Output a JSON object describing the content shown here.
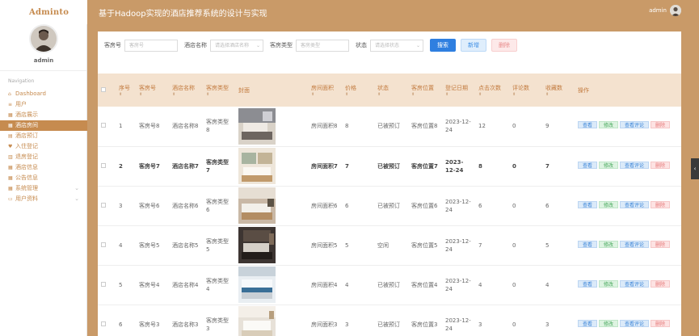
{
  "app": {
    "logo": "Adminto",
    "title": "基于Hadoop实现的酒店推荐系统的设计与实现",
    "user": "admin"
  },
  "sidebar": {
    "username": "admin",
    "nav_heading": "Navigation",
    "items": [
      {
        "icon": "home-icon",
        "glyph": "⌂",
        "label": "Dashboard"
      },
      {
        "icon": "list-icon",
        "glyph": "≡",
        "label": "用户"
      },
      {
        "icon": "grid-icon",
        "glyph": "▦",
        "label": "酒店展示"
      },
      {
        "icon": "grid-icon",
        "glyph": "▦",
        "label": "酒店房间",
        "active": true
      },
      {
        "icon": "book-icon",
        "glyph": "▤",
        "label": "酒店预订"
      },
      {
        "icon": "pin-icon",
        "glyph": "♥",
        "label": "入住登记"
      },
      {
        "icon": "checkout-icon",
        "glyph": "▥",
        "label": "退房登记"
      },
      {
        "icon": "grid-icon",
        "glyph": "▦",
        "label": "酒店信息"
      },
      {
        "icon": "grid-icon",
        "glyph": "▦",
        "label": "公告信息"
      },
      {
        "icon": "settings-icon",
        "glyph": "▦",
        "label": "系统管理",
        "expandable": true
      },
      {
        "icon": "profile-icon",
        "glyph": "▭",
        "label": "用户资料",
        "expandable": true
      }
    ]
  },
  "filters": [
    {
      "label": "客房号",
      "placeholder": "客房号",
      "dropdown": false
    },
    {
      "label": "酒店名称",
      "placeholder": "请选择酒店名称",
      "dropdown": true
    },
    {
      "label": "客房类型",
      "placeholder": "客房类型",
      "dropdown": false
    },
    {
      "label": "状态",
      "placeholder": "请选择状态",
      "dropdown": true
    }
  ],
  "buttons": {
    "search": "搜索",
    "add": "新增",
    "delete": "删除"
  },
  "table": {
    "headers": [
      "序号",
      "客房号",
      "酒店名称",
      "客房类型",
      "封面",
      "房间面积",
      "价格",
      "状态",
      "客房位置",
      "登记日期",
      "点击次数",
      "评论数",
      "收藏数",
      "操作"
    ],
    "actions": {
      "view": "查看",
      "edit": "修改",
      "comments": "查看评论",
      "delete": "删除"
    },
    "rows": [
      {
        "no": "1",
        "room": "客房号8",
        "hotel": "酒店名称8",
        "type": "客房类型8",
        "area": "房间面积8",
        "price": "8",
        "status": "已被预订",
        "location": "客房位置8",
        "date": "2023-12-24",
        "clicks": "12",
        "comments": "0",
        "favs": "9",
        "bold": false
      },
      {
        "no": "2",
        "room": "客房号7",
        "hotel": "酒店名称7",
        "type": "客房类型7",
        "area": "房间面积7",
        "price": "7",
        "status": "已被预订",
        "location": "客房位置7",
        "date": "2023-12-24",
        "clicks": "8",
        "comments": "0",
        "favs": "7",
        "bold": true
      },
      {
        "no": "3",
        "room": "客房号6",
        "hotel": "酒店名称6",
        "type": "客房类型6",
        "area": "房间面积6",
        "price": "6",
        "status": "已被预订",
        "location": "客房位置6",
        "date": "2023-12-24",
        "clicks": "6",
        "comments": "0",
        "favs": "6",
        "bold": false
      },
      {
        "no": "4",
        "room": "客房号5",
        "hotel": "酒店名称5",
        "type": "客房类型5",
        "area": "房间面积5",
        "price": "5",
        "status": "空闲",
        "location": "客房位置5",
        "date": "2023-12-24",
        "clicks": "7",
        "comments": "0",
        "favs": "5",
        "bold": false
      },
      {
        "no": "5",
        "room": "客房号4",
        "hotel": "酒店名称4",
        "type": "客房类型4",
        "area": "房间面积4",
        "price": "4",
        "status": "已被预订",
        "location": "客房位置4",
        "date": "2023-12-24",
        "clicks": "4",
        "comments": "0",
        "favs": "4",
        "bold": false
      },
      {
        "no": "6",
        "room": "客房号3",
        "hotel": "酒店名称3",
        "type": "客房类型3",
        "area": "房间面积3",
        "price": "3",
        "status": "已被预订",
        "location": "客房位置3",
        "date": "2023-12-24",
        "clicks": "3",
        "comments": "0",
        "favs": "3",
        "bold": false
      }
    ]
  },
  "colors": {
    "brand": "#c68b4f",
    "header_bg": "#c99a68",
    "table_head": "#f4e2cf",
    "primary": "#2f7fe0"
  }
}
